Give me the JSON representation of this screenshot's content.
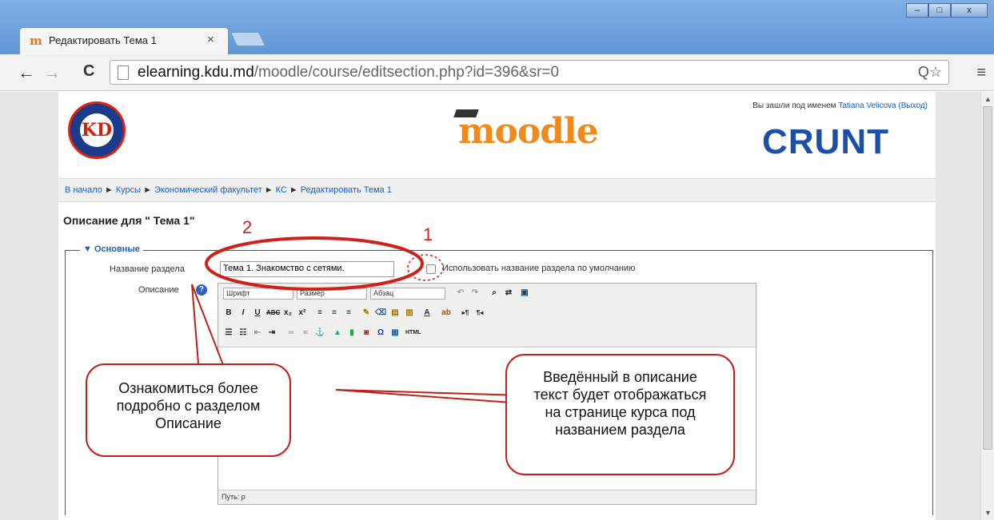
{
  "browser": {
    "tab_title": "Редактировать Тема 1",
    "tab_close": "×",
    "url_host": "elearning.kdu.md",
    "url_path": "/moodle/course/editsection.php?id=396&sr=0",
    "nav_back": "←",
    "nav_forward": "→",
    "nav_reload": "C",
    "omni_icons": "Q☆",
    "menu": "≡"
  },
  "header": {
    "kdu_logo_text": "KD",
    "moodle_logo": "moodle",
    "login_prefix": "Вы зашли под именем ",
    "user_name": "Tatiana Velicova",
    "logout": "(Выход)",
    "crunt_logo": "CRUNT"
  },
  "breadcrumb": {
    "items": [
      "В начало",
      "Курсы",
      "Экономический факультет",
      "КС",
      "Редактировать Тема 1"
    ],
    "separator": "►"
  },
  "form": {
    "heading": "Описание для \" Тема 1\"",
    "legend": "▼ Основные",
    "name_label": "Название раздела",
    "name_value": "Тема 1. Знакомство с сетями.",
    "default_label": "Использовать название раздела по умолчанию",
    "description_label": "Описание",
    "help_icon": "?"
  },
  "editor": {
    "font_select": "Шрифт",
    "size_select": "Размер",
    "format_select": "Абзац",
    "path": "Путь: p"
  },
  "annotations": {
    "num1": "1",
    "num2": "2",
    "bubble_left": "Ознакомиться более подробно с разделом Описание",
    "bubble_right": "Введённый в описание текст будет отображаться на странице курса под названием раздела"
  }
}
